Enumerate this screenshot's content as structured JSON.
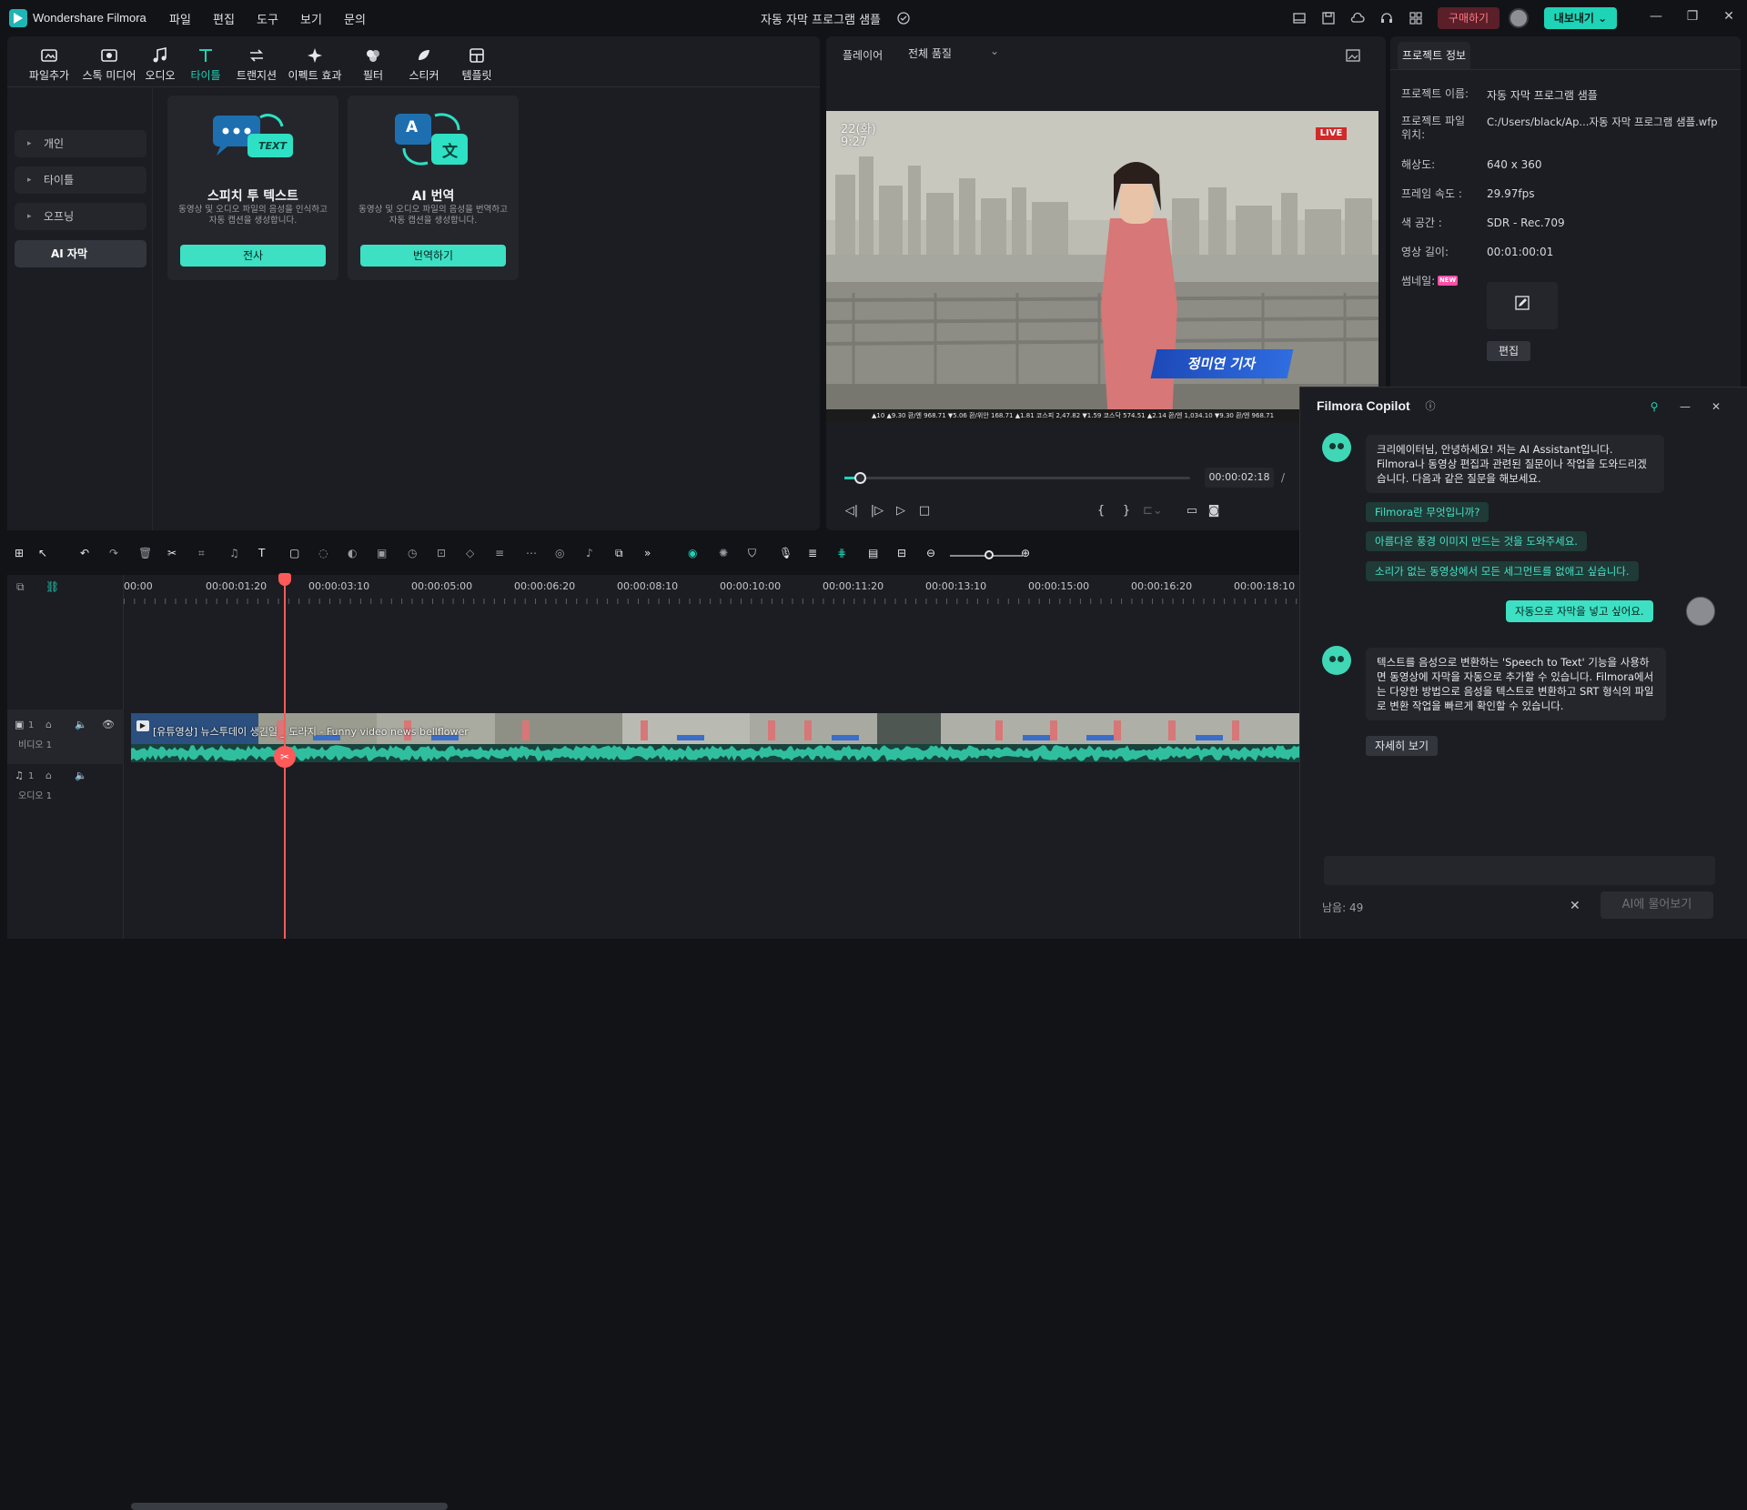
{
  "app": {
    "name": "Wondershare Filmora",
    "menu": [
      "파일",
      "편집",
      "도구",
      "보기",
      "문의"
    ],
    "project_title": "자동 자막 프로그램 샘플",
    "buy_label": "구매하기",
    "export_label": "내보내기"
  },
  "media_tabs": [
    {
      "label": "파일추가",
      "icon": "import-icon"
    },
    {
      "label": "스톡 미디어",
      "icon": "stock-media-icon"
    },
    {
      "label": "오디오",
      "icon": "music-note-icon"
    },
    {
      "label": "타이틀",
      "icon": "title-t-icon",
      "active": true
    },
    {
      "label": "트랜지션",
      "icon": "transition-icon"
    },
    {
      "label": "이펙트 효과",
      "icon": "effects-icon"
    },
    {
      "label": "필터",
      "icon": "filter-icon"
    },
    {
      "label": "스티커",
      "icon": "sticker-icon"
    },
    {
      "label": "템플릿",
      "icon": "template-icon"
    }
  ],
  "sidebar": {
    "items": [
      {
        "label": "개인"
      },
      {
        "label": "타이틀"
      },
      {
        "label": "오프닝"
      },
      {
        "label": "AI 자막",
        "active": true
      }
    ]
  },
  "cards": [
    {
      "title": "스피치 투 텍스트",
      "art_text": "TEXT",
      "desc": "동영상 및 오디오 파일의 음성을 인식하고 자동 캡션을 생성합니다.",
      "button": "전사"
    },
    {
      "title": "AI 번역",
      "art_text": "A",
      "art_text2": "文",
      "desc": "동영상 및 오디오 파일의 음성을 번역하고 자동 캡션을 생성합니다.",
      "button": "번역하기"
    }
  ],
  "player": {
    "label": "플레이어",
    "quality": "전체 품질",
    "timecode": "00:00:02:18",
    "progress": 0.045,
    "overlay": {
      "live": "LIVE",
      "clock_date": "22(화)",
      "clock_time": "9:27",
      "name_bar": "정미연 기자",
      "ticker": "▲10 ▲9.30  환/엔 968.71 ▼5.06  환/위안 168.71 ▲1.81  코스피 2,47.82 ▼1.59  코스닥 574.51 ▲2.14  환/엔 1,034.10 ▼9.30  환/엔 968.71"
    }
  },
  "project_info": {
    "tab": "프로젝트 정보",
    "rows": [
      {
        "label": "프로젝트 이름:",
        "value": "자동 자막 프로그램 샘플"
      },
      {
        "label": "프로젝트 파일 위치:",
        "value": "C:/Users/black/Ap...자동 자막 프로그램 샘플.wfp"
      },
      {
        "label": "해상도:",
        "value": "640 x 360"
      },
      {
        "label": "프레임 속도 :",
        "value": "29.97fps"
      },
      {
        "label": "색 공간 :",
        "value": "SDR - Rec.709"
      },
      {
        "label": "영상 길이:",
        "value": "00:01:00:01"
      },
      {
        "label": "썸네일:",
        "value": ""
      }
    ],
    "new_badge": "NEW",
    "edit_button": "편집"
  },
  "timeline": {
    "ruler": [
      "00:00",
      "00:00:01:20",
      "00:00:03:10",
      "00:00:05:00",
      "00:00:06:20",
      "00:00:08:10",
      "00:00:10:00",
      "00:00:11:20",
      "00:00:13:10",
      "00:00:15:00",
      "00:00:16:20",
      "00:00:18:10"
    ],
    "clip_label": "[유튜영상] 뉴스투데이 생긴일 _ 도라지 - Funny video news bellflower",
    "video_track": "비디오 1",
    "audio_track": "오디오 1",
    "video_track_num": "1",
    "audio_track_num": "1"
  },
  "copilot": {
    "title": "Filmora Copilot",
    "greeting": "크리에이터님, 안녕하세요! 저는 AI Assistant입니다. Filmora나 동영상 편집과 관련된 질문이나 작업을 도와드리겠습니다. 다음과 같은 질문을 해보세요.",
    "suggestions": [
      "Filmora란 무엇입니까?",
      "아름다운 풍경 이미지 만드는 것을 도와주세요.",
      "소리가 없는 동영상에서 모든 세그먼트를 없애고 싶습니다."
    ],
    "user_msg": "자동으로 자막을 넣고 싶어요.",
    "answer": "텍스트를 음성으로 변환하는 'Speech to Text' 기능을 사용하면 동영상에 자막을 자동으로 추가할 수 있습니다. Filmora에서는 다양한 방법으로 음성을 텍스트로 변환하고 SRT 형식의 파일로 변환 작업을 빠르게 확인할 수 있습니다.",
    "more": "자세히 보기",
    "remaining": "남음: 49",
    "ask_button": "AI에 물어보기",
    "input_placeholder": ""
  },
  "colors": {
    "accent": "#1fd3b7",
    "playhead": "#ff5a5a",
    "buy_bg": "#5a1f29"
  }
}
